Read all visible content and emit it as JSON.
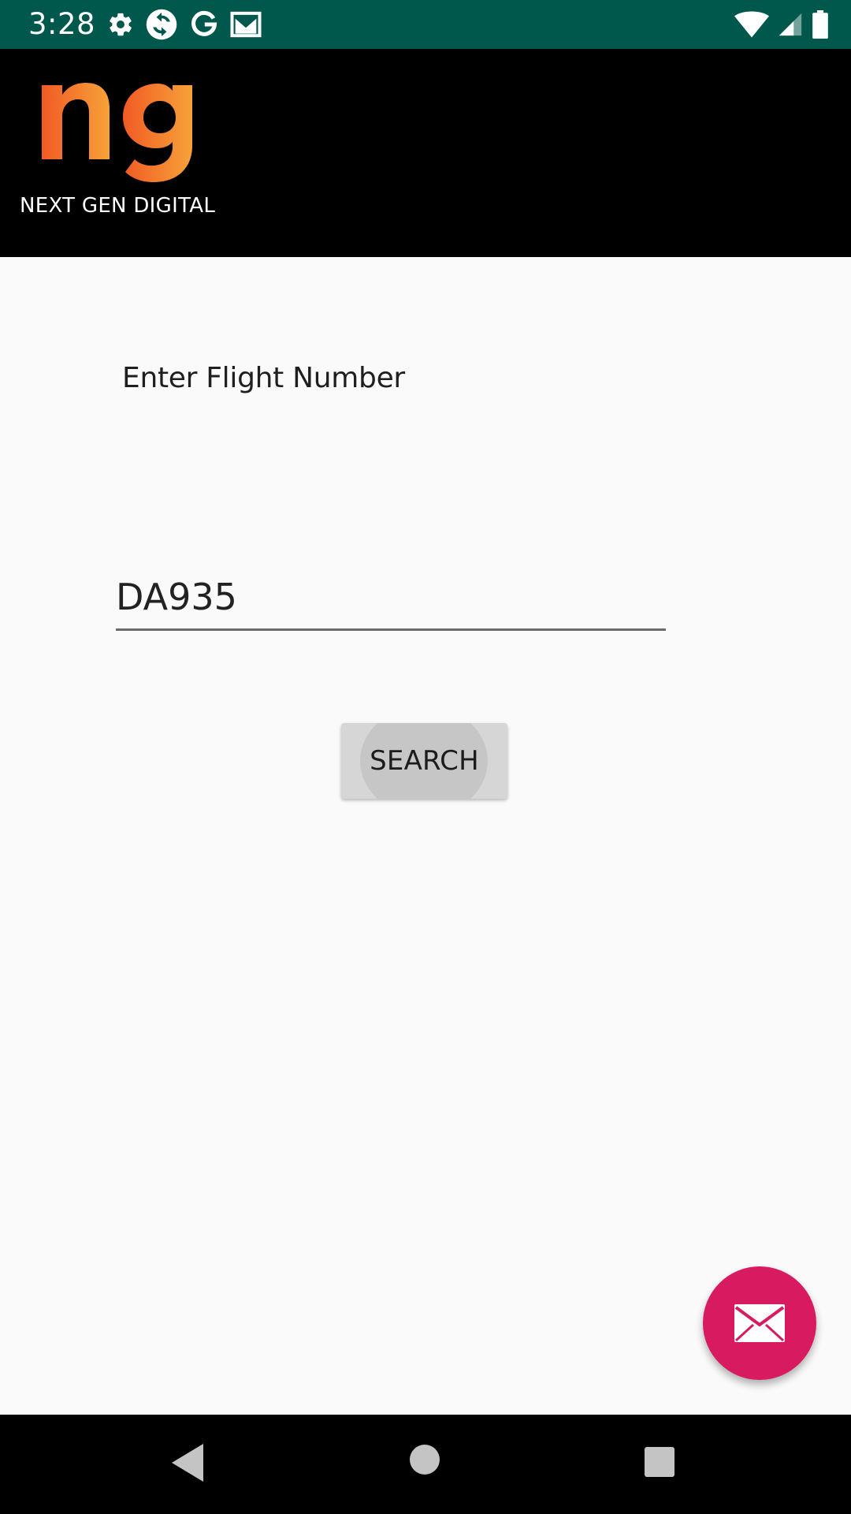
{
  "status_bar": {
    "time": "3:28",
    "bg_color": "#00574b",
    "left_icons": [
      "settings-icon",
      "sync-icon",
      "google-icon",
      "gmail-icon"
    ],
    "right_icons": [
      "wifi-icon",
      "cell-signal-icon",
      "battery-icon"
    ]
  },
  "header": {
    "logo_letters": "ng",
    "brand_name": "NEXT GEN DIGITAL",
    "logo_color": "#f47a20"
  },
  "main": {
    "prompt_label": "Enter Flight Number",
    "flight_input_value": "DA935",
    "search_button_label": "SEARCH"
  },
  "fab": {
    "icon": "mail-icon",
    "color": "#d81b60"
  },
  "nav_bar": {
    "buttons": [
      "back-icon",
      "home-icon",
      "recents-icon"
    ]
  }
}
